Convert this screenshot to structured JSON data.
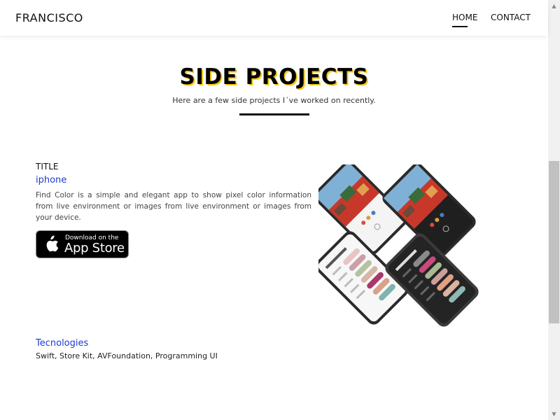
{
  "nav": {
    "brand": "FRANCISCO",
    "links": [
      "HOME",
      "CONTACT"
    ],
    "active": "HOME"
  },
  "section": {
    "title": "SIDE PROJECTS",
    "subtitle": "Here are a few side projects I´ve worked on recently."
  },
  "project": {
    "label": "TITLE",
    "platform": "iphone",
    "description": "Find Color is a simple and elegant app to show pixel color information from live environment or images from live environment or images from your device.",
    "appstore": {
      "small": "Download on the",
      "big": "App Store"
    },
    "tech_title": "Tecnologies",
    "tech_list": "Swift, Store Kit, AVFoundation, Programming UI",
    "image_icon": "app-screenshots-phones"
  },
  "colors": {
    "accent": "#f5c518",
    "link": "#1d3bd1",
    "text": "#111111"
  }
}
